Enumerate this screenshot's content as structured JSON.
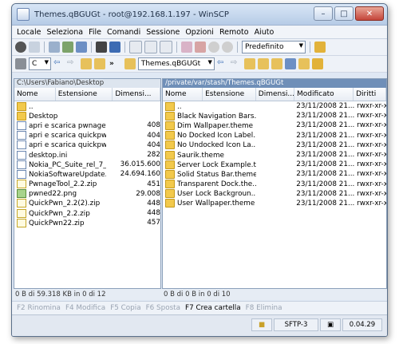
{
  "window": {
    "title": "Themes.qBGUGt - root@192.168.1.197 - WinSCP"
  },
  "menu": [
    "Locale",
    "Seleziona",
    "File",
    "Comandi",
    "Sessione",
    "Opzioni",
    "Remoto",
    "Aiuto"
  ],
  "toolbar": {
    "preset": "Predefinito"
  },
  "left_pane": {
    "drive": "C",
    "path": "C:\\Users\\Fabiano\\Desktop",
    "columns": [
      "Nome",
      "Estensione",
      "Dimensi..."
    ],
    "files": [
      {
        "name": "..",
        "size": "",
        "icon": "up-folder-icon"
      },
      {
        "name": "Desktop",
        "size": "",
        "icon": "folder-icon"
      },
      {
        "name": "apri e scarica pwnaget...",
        "size": "408",
        "icon": "shortcut-icon"
      },
      {
        "name": "apri e scarica quickpw...",
        "size": "404",
        "icon": "shortcut-icon"
      },
      {
        "name": "apri e scarica quickpw...",
        "size": "404",
        "icon": "shortcut-icon"
      },
      {
        "name": "desktop.ini",
        "size": "282",
        "icon": "file-icon"
      },
      {
        "name": "Nokia_PC_Suite_rel_7_...",
        "size": "36.015.600",
        "icon": "file-icon"
      },
      {
        "name": "NokiaSoftwareUpdate...",
        "size": "24.694.160",
        "icon": "file-icon"
      },
      {
        "name": "PwnageTool_2.2.zip",
        "size": "451",
        "icon": "zip-icon"
      },
      {
        "name": "pwned22.png",
        "size": "29.008",
        "icon": "image-icon"
      },
      {
        "name": "QuickPwn_2.2(2).zip",
        "size": "448",
        "icon": "zip-icon"
      },
      {
        "name": "QuickPwn_2.2.zip",
        "size": "448",
        "icon": "zip-icon"
      },
      {
        "name": "QuickPwn22.zip",
        "size": "457",
        "icon": "zip-icon"
      }
    ],
    "status": "0 B di 59.318 KB in 0 di 12"
  },
  "right_pane": {
    "folder": "Themes.qBGUGt",
    "path": "/private/var/stash/Themes.qBGUGt",
    "columns": [
      "Nome",
      "Estensione",
      "Dimensi...",
      "Modificato",
      "Diritti"
    ],
    "files": [
      {
        "name": "..",
        "modified": "23/11/2008 21....",
        "rights": "rwxr-xr-x",
        "icon": "up-folder-icon"
      },
      {
        "name": "Black Navigation Bars....",
        "modified": "23/11/2008 21....",
        "rights": "rwxr-xr-x",
        "icon": "folder-icon"
      },
      {
        "name": "Dim Wallpaper.theme",
        "modified": "23/11/2008 21....",
        "rights": "rwxr-xr-x",
        "icon": "folder-icon"
      },
      {
        "name": "No Docked Icon Label...",
        "modified": "23/11/2008 21....",
        "rights": "rwxr-xr-x",
        "icon": "folder-icon"
      },
      {
        "name": "No Undocked Icon La...",
        "modified": "23/11/2008 21....",
        "rights": "rwxr-xr-x",
        "icon": "folder-icon"
      },
      {
        "name": "Saurik.theme",
        "modified": "23/11/2008 21....",
        "rights": "rwxr-xr-x",
        "icon": "folder-icon"
      },
      {
        "name": "Server Lock Example.t...",
        "modified": "23/11/2008 21....",
        "rights": "rwxr-xr-x",
        "icon": "folder-icon"
      },
      {
        "name": "Solid Status Bar.theme",
        "modified": "23/11/2008 21....",
        "rights": "rwxr-xr-x",
        "icon": "folder-icon"
      },
      {
        "name": "Transparent Dock.the...",
        "modified": "23/11/2008 21....",
        "rights": "rwxr-xr-x",
        "icon": "folder-icon"
      },
      {
        "name": "User Lock Backgroun...",
        "modified": "23/11/2008 21....",
        "rights": "rwxr-xr-x",
        "icon": "folder-icon"
      },
      {
        "name": "User Wallpaper.theme",
        "modified": "23/11/2008 21....",
        "rights": "rwxr-xr-x",
        "icon": "folder-icon"
      }
    ],
    "status": "0 B di 0 B in 0 di 10"
  },
  "fkeys": [
    {
      "label": "F2 Rinomina",
      "enabled": false
    },
    {
      "label": "F4 Modifica",
      "enabled": false
    },
    {
      "label": "F5 Copia",
      "enabled": false
    },
    {
      "label": "F6 Sposta",
      "enabled": false
    },
    {
      "label": "F7 Crea cartella",
      "enabled": true
    },
    {
      "label": "F8 Elimina",
      "enabled": false
    }
  ],
  "statusbar": {
    "protocol": "SFTP-3",
    "time": "0.04.29"
  }
}
